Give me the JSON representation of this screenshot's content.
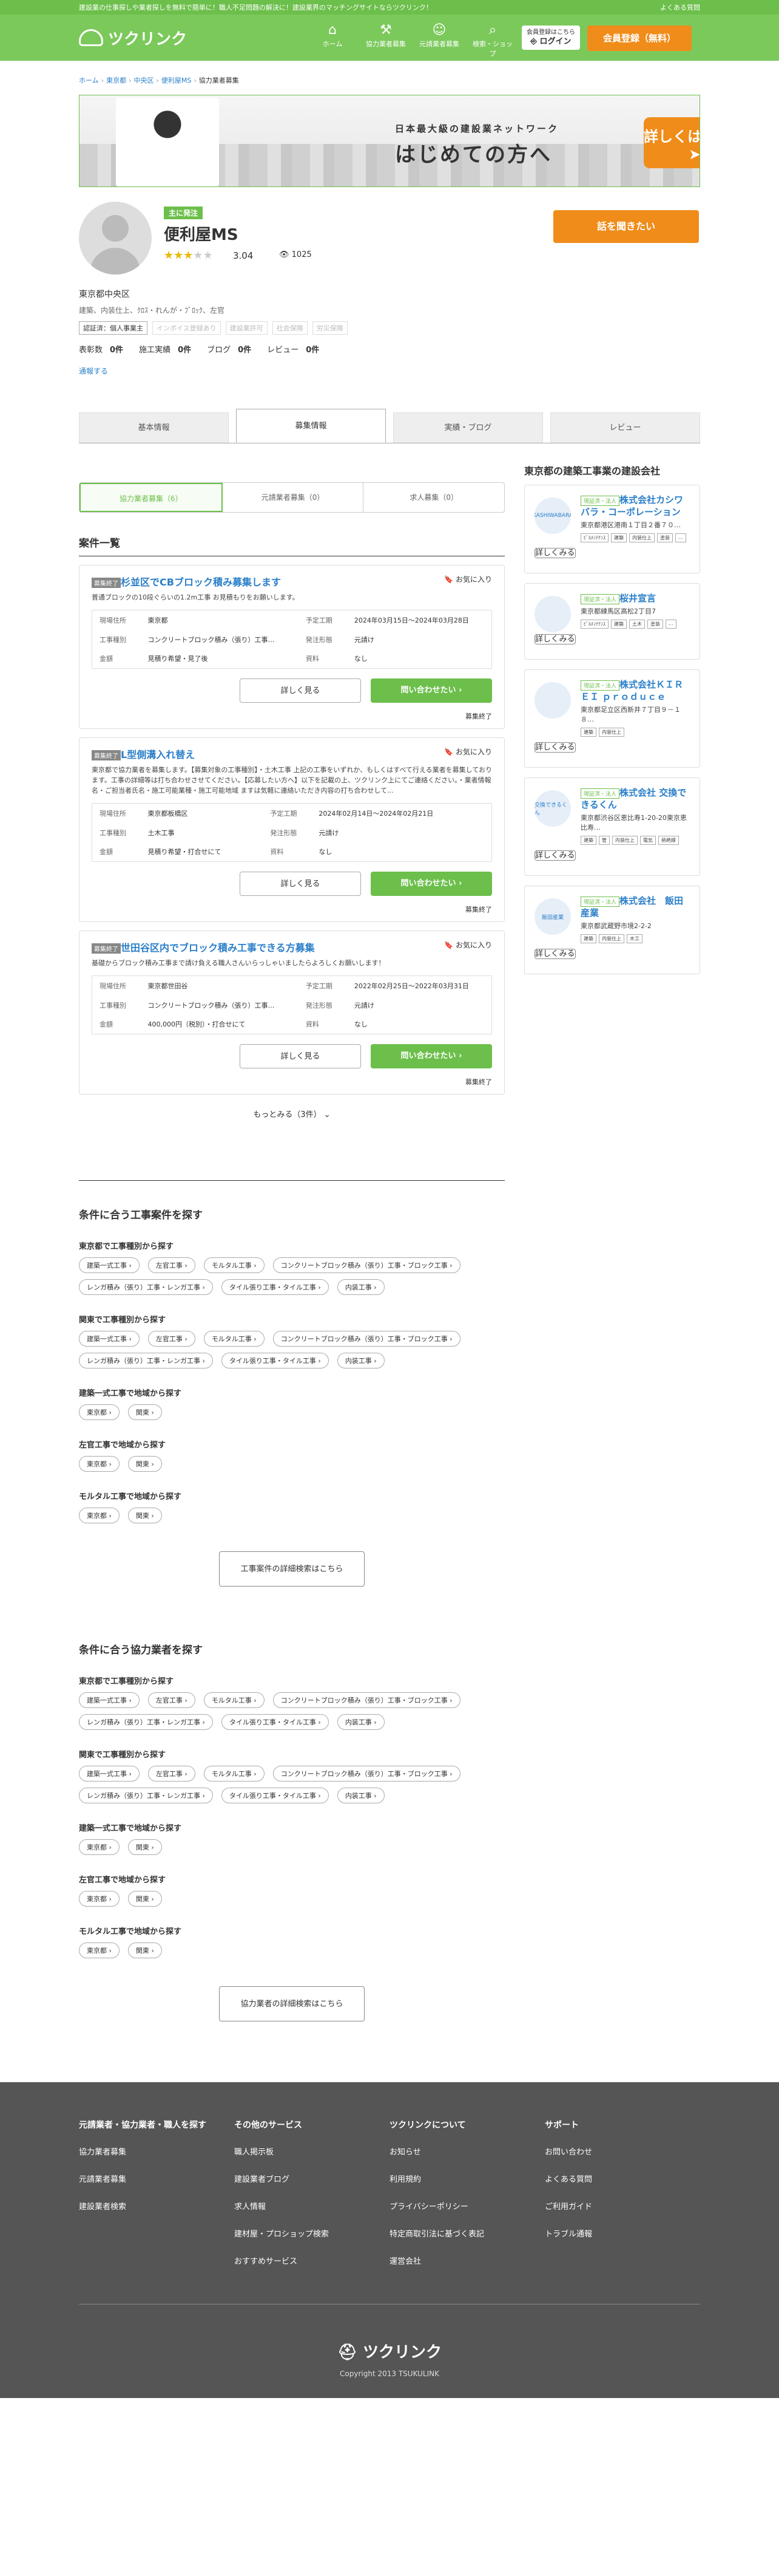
{
  "topbar": {
    "left": "建設業の仕事探しや業者探しを無料で簡単に！職人不足問題の解決に！建設業界のマッチングサイトならツクリンク！",
    "right": "よくある質問"
  },
  "header": {
    "logo": "ツクリンク",
    "nav": [
      {
        "label": "ホーム",
        "icon": "home-icon",
        "glyph": "⌂"
      },
      {
        "label": "協力業者募集",
        "icon": "hammer-icon",
        "glyph": "⚒"
      },
      {
        "label": "元請業者募集",
        "icon": "worker-icon",
        "glyph": "☺"
      },
      {
        "label": "検索・ショップ",
        "icon": "search-icon",
        "glyph": "⌕"
      }
    ],
    "login_sub": "会員登録はこちら",
    "login": "ログイン",
    "signup": "会員登録（無料）"
  },
  "breadcrumb": [
    "ホーム",
    "東京都",
    "中央区",
    "便利屋MS",
    "協力業者募集"
  ],
  "banner": {
    "line1": "日本最大級の建設業ネットワーク",
    "line2": "はじめての方へ",
    "button": "詳しくはこちら"
  },
  "profile": {
    "role": "主に発注",
    "name": "便利屋MS",
    "rating": 3,
    "score": "3.04",
    "views": "1025",
    "contact": "話を聞きたい",
    "area": "東京都中央区",
    "trades": "建築、内装仕上、ｸﾛｽ・れんが・ﾌﾞﾛｯｸ、左官",
    "certs": [
      {
        "label": "認証済：個人事業主",
        "on": true
      },
      {
        "label": "インボイス登録あり",
        "on": false
      },
      {
        "label": "建設業許可",
        "on": false
      },
      {
        "label": "社会保険",
        "on": false
      },
      {
        "label": "労災保険",
        "on": false
      }
    ],
    "counts": [
      {
        "k": "表彰数",
        "v": "0件"
      },
      {
        "k": "施工実績",
        "v": "0件"
      },
      {
        "k": "ブログ",
        "v": "0件"
      },
      {
        "k": "レビュー",
        "v": "0件"
      }
    ],
    "viewed": "通報する"
  },
  "tabs": [
    "基本情報",
    "募集情報",
    "実績・ブログ",
    "レビュー"
  ],
  "subtabs": [
    "協力業者募集（6）",
    "元請業者募集（0）",
    "求人募集（0）"
  ],
  "list_title": "案件一覧",
  "jobs": [
    {
      "badge": "募集終了",
      "fav": "お気に入り",
      "title": "杉並区でCBブロック積み募集します",
      "desc": "普通ブロックの10段ぐらいの1.2m工事 お見積もりをお願いします。",
      "rows": [
        [
          "現場住所",
          "東京都",
          "予定工期",
          "2024年03月15日〜2024年03月28日"
        ],
        [
          "工事種別",
          "コンクリートブロック積み（張り）工事…",
          "発注形態",
          "元請け"
        ],
        [
          "金額",
          "見積り希望・見了後",
          "資料",
          "なし"
        ]
      ],
      "detail": "詳しく見る",
      "inquire": "問い合わせたい",
      "end": "募集終了"
    },
    {
      "badge": "募集終了",
      "fav": "お気に入り",
      "title": "L型側溝入れ替え",
      "desc": "東京都で協力業者を募集します。【募集対象の工事種別】・土木工事 上記の工事をいずれか、もしくはすべて行える業者を募集しております。工事の詳細等は打ち合わせさせてください。【応募したい方へ】以下を記載の上、ツクリンク上にてご連絡ください。・業者情報名・ご担当者氏名・施工可能業種・施工可能地域 ますは気軽に連絡いただき内容の打ち合わせして...",
      "rows": [
        [
          "現場住所",
          "東京都板橋区",
          "予定工期",
          "2024年02月14日〜2024年02月21日"
        ],
        [
          "工事種別",
          "土木工事",
          "発注形態",
          "元請け"
        ],
        [
          "金額",
          "見積り希望・打合せにて",
          "資料",
          "なし"
        ]
      ],
      "detail": "詳しく見る",
      "inquire": "問い合わせたい",
      "end": "募集終了"
    },
    {
      "badge": "募集終了",
      "fav": "お気に入り",
      "title": "世田谷区内でブロック積み工事できる方募集",
      "desc": "基礎からブロック積み工事まで請け負える職人さんいらっしゃいましたらよろしくお願いします！",
      "rows": [
        [
          "現場住所",
          "東京都世田谷",
          "予定工期",
          "2022年02月25日〜2022年03月31日"
        ],
        [
          "工事種別",
          "コンクリートブロック積み（張り）工事…",
          "発注形態",
          "元請け"
        ],
        [
          "金額",
          "400,000円（税別）・打合せにて",
          "資料",
          "なし"
        ]
      ],
      "detail": "詳しく見る",
      "inquire": "問い合わせたい",
      "end": "募集終了"
    }
  ],
  "more": "もっとみる（3件）",
  "sidebar": {
    "title": "東京都の建築工事業の建設会社",
    "companies": [
      {
        "badge": "現証済・法人",
        "name": "株式会社カシワバラ・コーポレーション",
        "addr": "東京都港区港南１丁目２番７０…",
        "tags": [
          "ﾋﾞﾙﾒﾝﾃﾅﾝｽ",
          "建築",
          "内装仕上",
          "塗装",
          "..."
        ],
        "logo": "KASHIWABARA",
        "btn": "詳しくみる"
      },
      {
        "badge": "現証済・法人",
        "name": "桜井宣言",
        "addr": "東京都練馬区高松2丁目7",
        "tags": [
          "ﾋﾞﾙﾒﾝﾃﾅﾝｽ",
          "建築",
          "土木",
          "塗装",
          "..."
        ],
        "logo": "",
        "btn": "詳しくみる"
      },
      {
        "badge": "現証済・法人",
        "name": "株式会社ＫＩＲＥＩ ｐｒｏｄｕｃｅ",
        "addr": "東京都足立区西新井７丁目９－１８…",
        "tags": [
          "建築",
          "内装仕上"
        ],
        "logo": "",
        "btn": "詳しくみる"
      },
      {
        "badge": "現証済・法人",
        "name": "株式会社 交換できるくん",
        "addr": "東京都渋谷区恵比寿1-20-20東京恵比寿…",
        "tags": [
          "建築",
          "管",
          "内装仕上",
          "電気",
          "熱絶縁"
        ],
        "logo": "交換できるくん",
        "btn": "詳しくみる"
      },
      {
        "badge": "現証済・法人",
        "name": "株式会社　飯田産業",
        "addr": "東京都武蔵野市境2-2-2",
        "tags": [
          "建築",
          "内装仕上",
          "木工"
        ],
        "logo": "飯田産業",
        "btn": "詳しくみる"
      }
    ]
  },
  "search_jobs": {
    "title": "条件に合う工事案件を探す",
    "groups": [
      {
        "h": "東京都で工事種別から探す",
        "chips": [
          "建築一式工事",
          "左官工事",
          "モルタル工事",
          "コンクリートブロック積み（張り）工事・ブロック工事",
          "レンガ積み（張り）工事・レンガ工事",
          "タイル張り工事・タイル工事",
          "内装工事"
        ]
      },
      {
        "h": "関東で工事種別から探す",
        "chips": [
          "建築一式工事",
          "左官工事",
          "モルタル工事",
          "コンクリートブロック積み（張り）工事・ブロック工事",
          "レンガ積み（張り）工事・レンガ工事",
          "タイル張り工事・タイル工事",
          "内装工事"
        ]
      },
      {
        "h": "建築一式工事で地域から探す",
        "chips": [
          "東京都",
          "関東"
        ]
      },
      {
        "h": "左官工事で地域から探す",
        "chips": [
          "東京都",
          "関東"
        ]
      },
      {
        "h": "モルタル工事で地域から探す",
        "chips": [
          "東京都",
          "関東"
        ]
      }
    ],
    "button": "工事案件の詳細検索はこちら"
  },
  "search_partners": {
    "title": "条件に合う協力業者を探す",
    "groups": [
      {
        "h": "東京都で工事種別から探す",
        "chips": [
          "建築一式工事",
          "左官工事",
          "モルタル工事",
          "コンクリートブロック積み（張り）工事・ブロック工事",
          "レンガ積み（張り）工事・レンガ工事",
          "タイル張り工事・タイル工事",
          "内装工事"
        ]
      },
      {
        "h": "関東で工事種別から探す",
        "chips": [
          "建築一式工事",
          "左官工事",
          "モルタル工事",
          "コンクリートブロック積み（張り）工事・ブロック工事",
          "レンガ積み（張り）工事・レンガ工事",
          "タイル張り工事・タイル工事",
          "内装工事"
        ]
      },
      {
        "h": "建築一式工事で地域から探す",
        "chips": [
          "東京都",
          "関東"
        ]
      },
      {
        "h": "左官工事で地域から探す",
        "chips": [
          "東京都",
          "関東"
        ]
      },
      {
        "h": "モルタル工事で地域から探す",
        "chips": [
          "東京都",
          "関東"
        ]
      }
    ],
    "button": "協力業者の詳細検索はこちら"
  },
  "footer": {
    "cols": [
      {
        "h": "元請業者・協力業者・職人を探す",
        "items": [
          "協力業者募集",
          "元請業者募集",
          "建設業者検索"
        ]
      },
      {
        "h": "その他のサービス",
        "items": [
          "職人掲示板",
          "建設業者ブログ",
          "求人情報",
          "建材屋・プロショップ検索",
          "おすすめサービス"
        ]
      },
      {
        "h": "ツクリンクについて",
        "items": [
          "お知らせ",
          "利用規約",
          "プライバシーポリシー",
          "特定商取引法に基づく表記",
          "運営会社"
        ]
      },
      {
        "h": "サポート",
        "items": [
          "お問い合わせ",
          "よくある質問",
          "ご利用ガイド",
          "トラブル通報"
        ]
      }
    ],
    "logo": "ツクリンク",
    "copyright": "Copyright 2013 TSUKULINK"
  }
}
